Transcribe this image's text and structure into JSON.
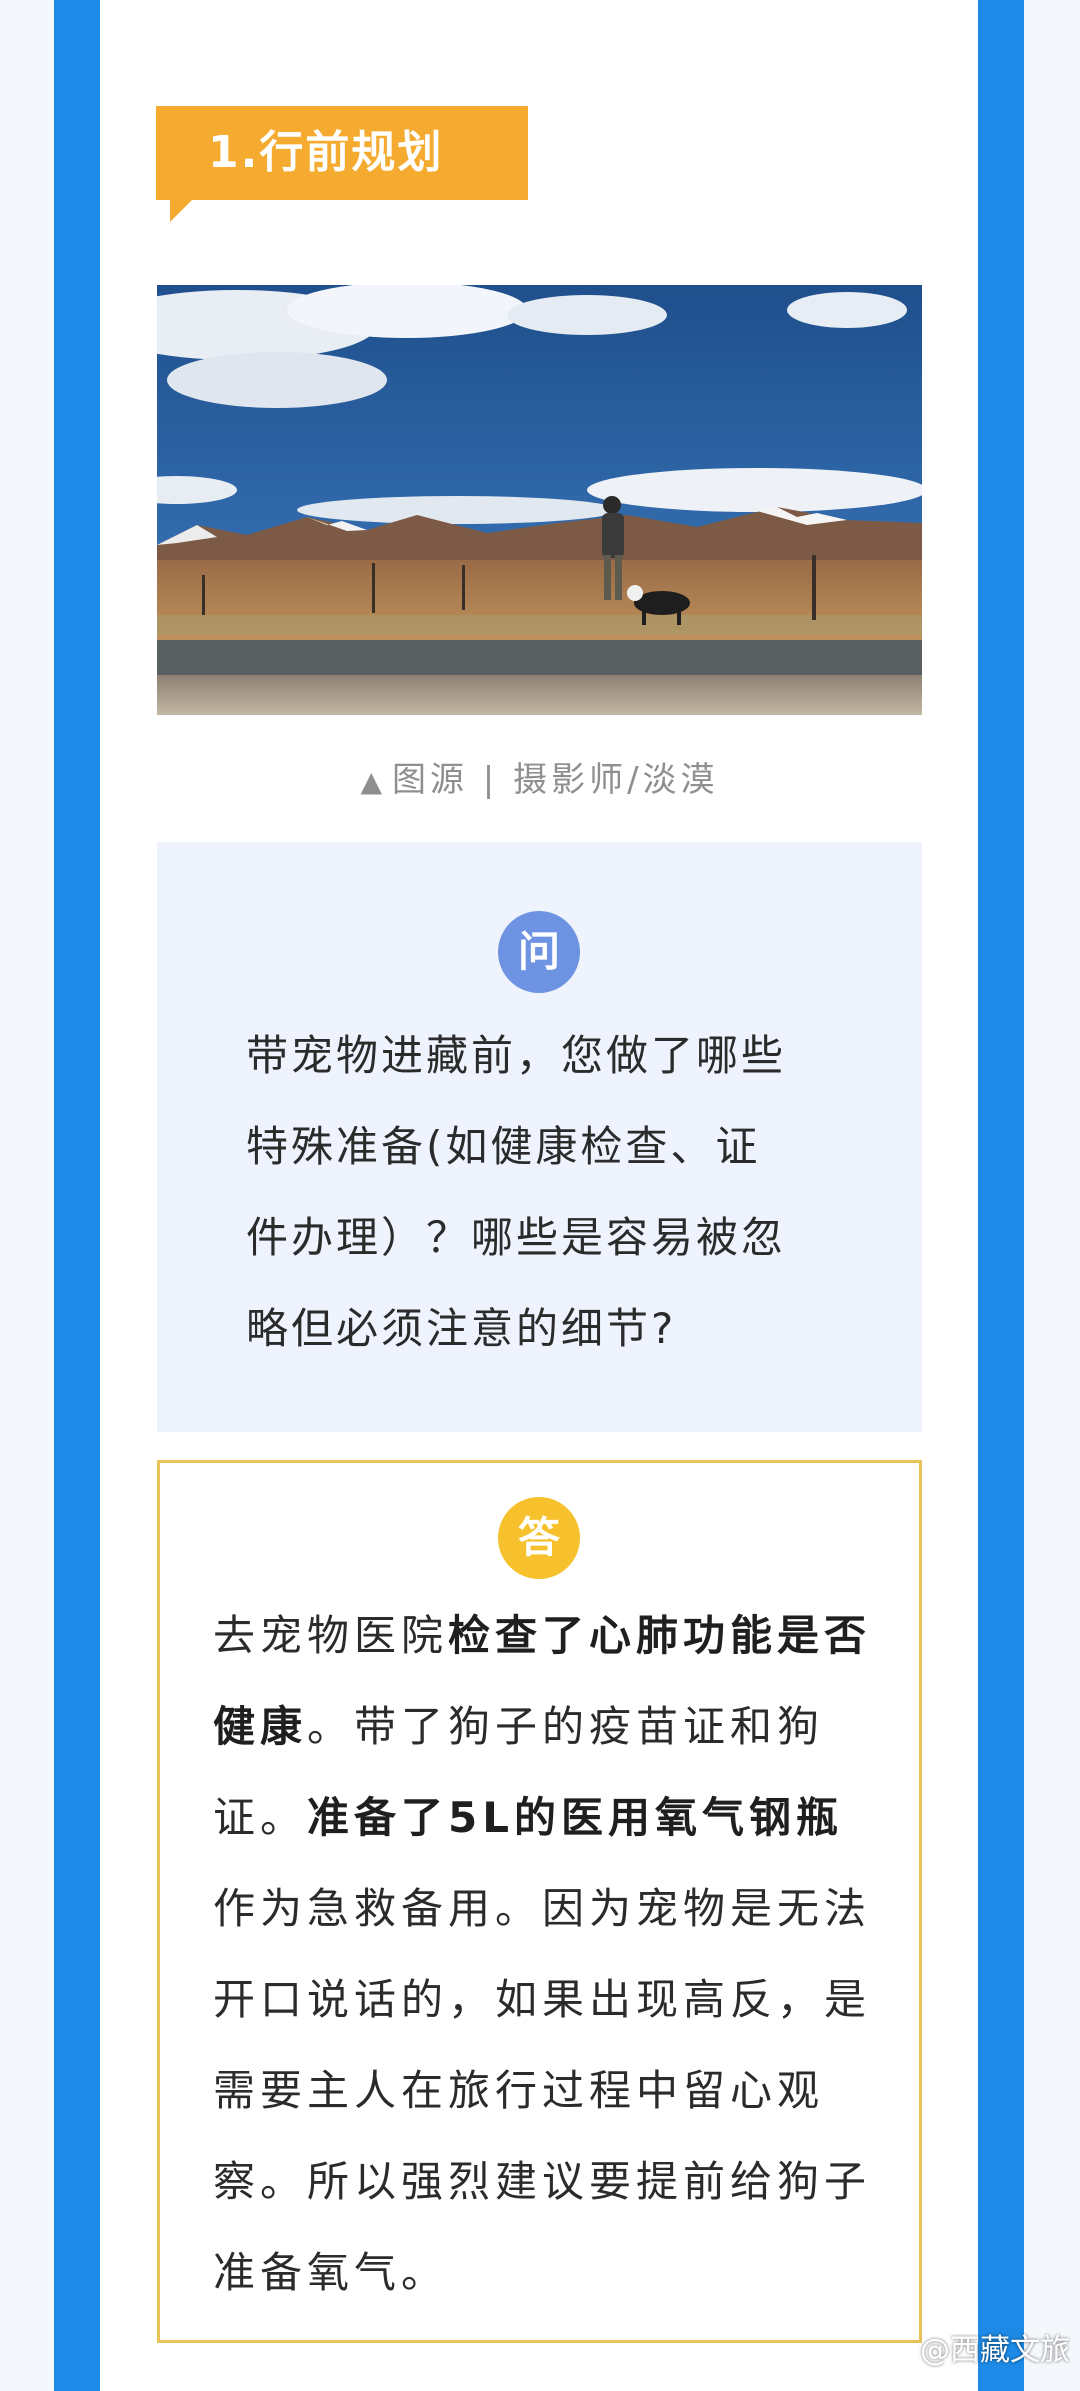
{
  "section": {
    "title": "1.行前规划"
  },
  "photo": {
    "caption_prefix": "▲",
    "caption": "图源 | 摄影师/淡漠"
  },
  "question": {
    "badge": "问",
    "lines": [
      "带宠物进藏前，您做了哪些",
      "特殊准备(如健康检查、证",
      "件办理）？哪些是容易被忽",
      "略但必须注意的细节?"
    ]
  },
  "answer": {
    "badge": "答",
    "seg1": "去宠物医院",
    "seg2_bold": "检查了心肺功能是否健康",
    "seg3": "。带了狗子的疫苗证和狗证。",
    "seg4_bold": "准备了5L的医用氧气钢瓶",
    "seg5": "作为急救备用。因为宠物是无法开口说话的，如果出现高反，是需要主人在旅行过程中留心观察。所以强烈建议要提前给狗子准备氧气。"
  },
  "watermark": "@西藏文旅",
  "colors": {
    "blue_border": "#1c8ae6",
    "tag_orange": "#f4ab2f",
    "q_badge": "#6f93e3",
    "a_badge": "#f6c12d",
    "a_border": "#e8c35a",
    "q_bg": "#eef3fd"
  }
}
